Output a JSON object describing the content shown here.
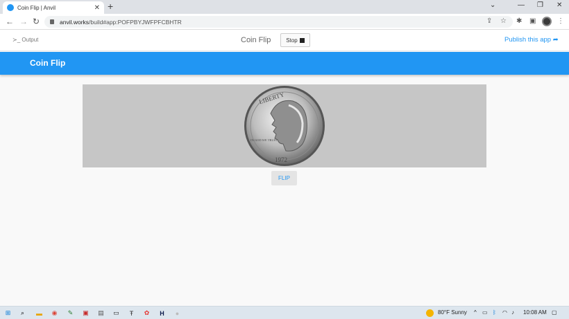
{
  "browser": {
    "tab_title": "Coin Flip | Anvil",
    "new_tab": "+",
    "url_host": "anvil.works",
    "url_path": "/build#app:POFPBYJWFPFCBHTR"
  },
  "ide": {
    "output_label": "Output",
    "app_name": "Coin Flip",
    "stop_label": "Stop",
    "publish_label": "Publish this app"
  },
  "app": {
    "title": "Coin Flip",
    "flip_label": "FLIP",
    "coin_text": "LIBERTY",
    "coin_motto": "IN GOD WE TRUST",
    "coin_year": "1972"
  },
  "taskbar": {
    "weather": "80°F  Sunny",
    "time": "10:08 AM"
  },
  "colors": {
    "accent": "#2196f3",
    "image_bg": "#c6c6c6"
  }
}
